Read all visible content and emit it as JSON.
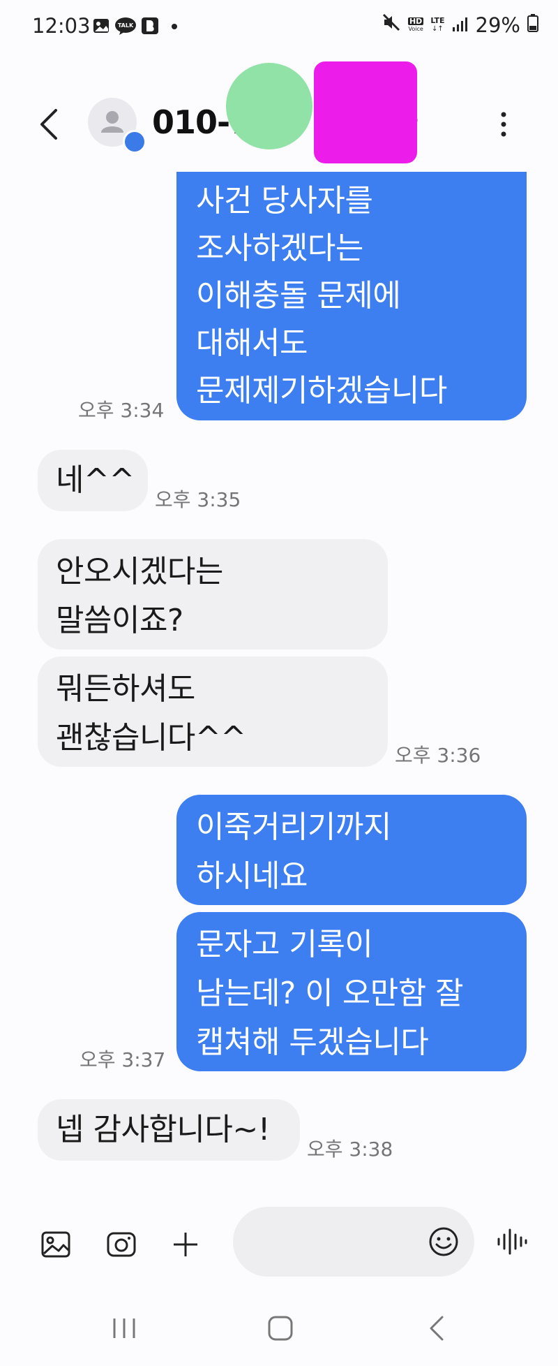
{
  "status_bar": {
    "time": "12:03",
    "battery": "29%",
    "network_hd": "HD",
    "network_hd_sub": "Voice",
    "network_lte": "LTE",
    "notification_icons": [
      "gallery-icon",
      "talk-icon",
      "b-app-icon",
      "dot-icon"
    ],
    "status_icons": [
      "mute-icon",
      "hd-voice-icon",
      "lte-icon",
      "signal-icon",
      "battery-icon"
    ]
  },
  "header": {
    "contact_name": "010-7",
    "contact_name_tail": "-"
  },
  "messages": [
    {
      "type": "sent",
      "lines": [
        "사건 당사자를",
        "조사하겠다는",
        "이해충돌 문제에",
        "대해서도",
        "문제제기하겠습니다"
      ],
      "time": "오후 3:34"
    },
    {
      "type": "received",
      "lines": [
        "네^^"
      ],
      "time": "오후 3:35"
    },
    {
      "type": "received",
      "lines": [
        "안오시겠다는",
        "말씀이죠?"
      ],
      "time": ""
    },
    {
      "type": "received",
      "lines": [
        "뭐든하셔도",
        "괜찮습니다^^"
      ],
      "time": "오후 3:36"
    },
    {
      "type": "sent",
      "lines": [
        "이죽거리기까지",
        "하시네요"
      ],
      "time": ""
    },
    {
      "type": "sent",
      "lines": [
        "문자고 기록이",
        "남는데? 이 오만함 잘",
        "캡쳐해 두겠습니다"
      ],
      "time": "오후 3:37"
    },
    {
      "type": "received",
      "lines": [
        "넵 감사합니다~!"
      ],
      "time": "오후 3:38"
    }
  ],
  "composer": {
    "placeholder": "",
    "icons": [
      "gallery-icon",
      "camera-icon",
      "plus-icon",
      "emoji-icon",
      "voice-icon"
    ]
  },
  "nav_bar": {
    "icons": [
      "recents-icon",
      "home-icon",
      "back-icon"
    ]
  },
  "colors": {
    "sent_bubble": "#3d7ef0",
    "received_bubble": "#f0f0f2",
    "background": "#fcfcff",
    "timestamp": "#757575",
    "avatar_badge": "#3a7be8"
  }
}
